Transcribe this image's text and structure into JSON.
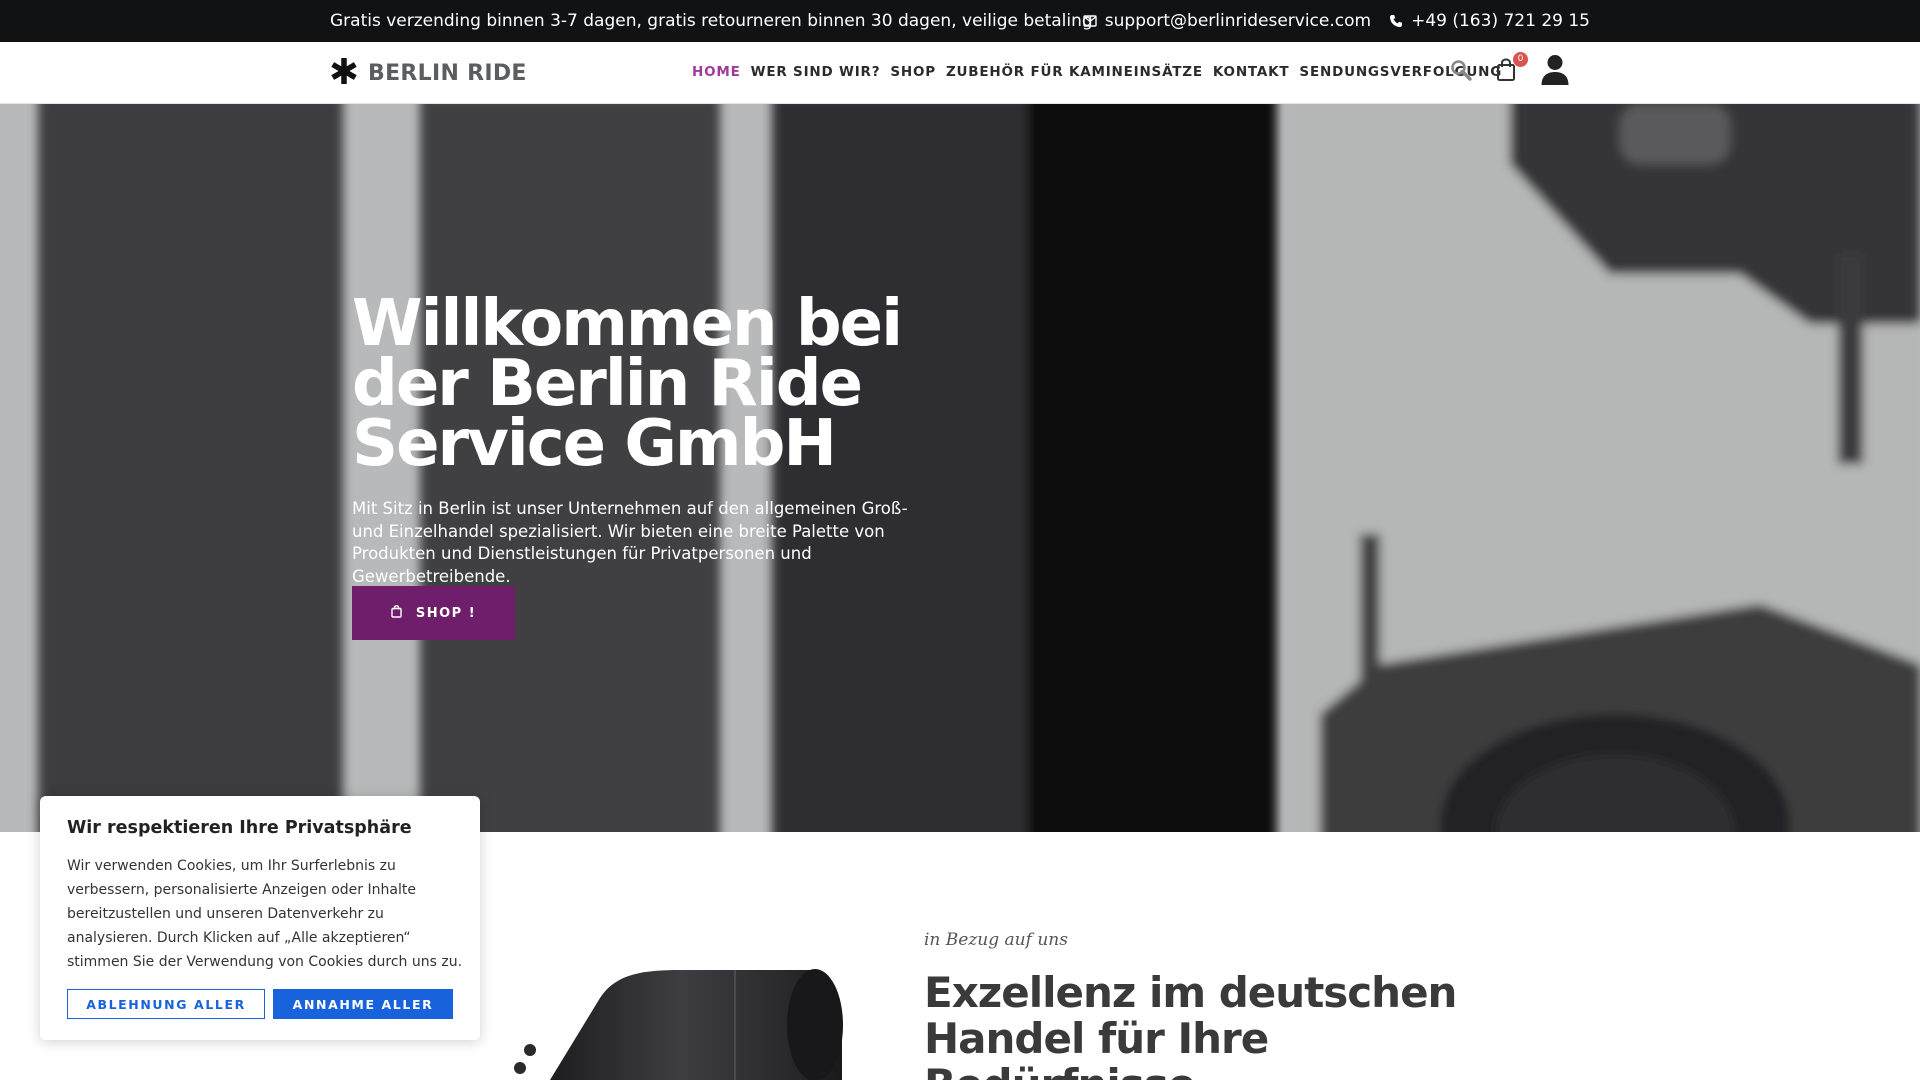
{
  "topbar": {
    "promo": "Gratis verzending binnen 3-7 dagen, gratis retourneren binnen 30 dagen, veilige betaling",
    "email": "support@berlinrideservice.com",
    "phone": "+49 (163) 721 29 15",
    "email_icon": "envelope-icon",
    "phone_icon": "phone-icon"
  },
  "header": {
    "logo_text": "BERLIN RIDE",
    "logo_icon": "asterisk-icon",
    "nav": [
      {
        "label": "HOME",
        "active": true
      },
      {
        "label": "WER SIND WIR?",
        "active": false
      },
      {
        "label": "SHOP",
        "active": false
      },
      {
        "label": "ZUBEHÖR FÜR KAMINEINSÄTZE",
        "active": false
      },
      {
        "label": "KONTAKT",
        "active": false
      },
      {
        "label": "SENDUNGSVERFOLGUNG",
        "active": false
      }
    ],
    "cart_count": "0",
    "icons": [
      "search-icon",
      "shopping-bag-icon",
      "user-icon"
    ]
  },
  "hero": {
    "title": "Willkommen bei der Berlin Ride Service GmbH",
    "text": "Mit Sitz in Berlin ist unser Unternehmen auf den allgemeinen Groß- und Einzelhandel spezialisiert. Wir bieten eine breite Palette von Produkten und Dienstleistungen für Privatpersonen und Gewerbetreibende.",
    "button_label": "SHOP !",
    "button_icon": "shopping-bag-icon"
  },
  "about": {
    "tagline": "in Bezug auf uns",
    "title": "Exzellenz im deutschen Handel für Ihre Bedürfnisse"
  },
  "cookie_banner": {
    "title": "Wir respektieren Ihre Privatsphäre",
    "text": "Wir verwenden Cookies, um Ihr Surferlebnis zu verbessern, personalisierte Anzeigen oder Inhalte bereitzustellen und unseren Datenverkehr zu analysieren. Durch Klicken auf „Alle akzeptieren“ stimmen Sie der Verwendung von Cookies durch uns zu.",
    "reject_label": "ABLEHNUNG ALLER",
    "accept_label": "ANNAHME ALLER"
  },
  "colors": {
    "accent_purple": "#6e1e6b",
    "nav_active": "#a23a9c",
    "cookie_blue": "#1863dc",
    "topbar_bg": "#111214"
  }
}
